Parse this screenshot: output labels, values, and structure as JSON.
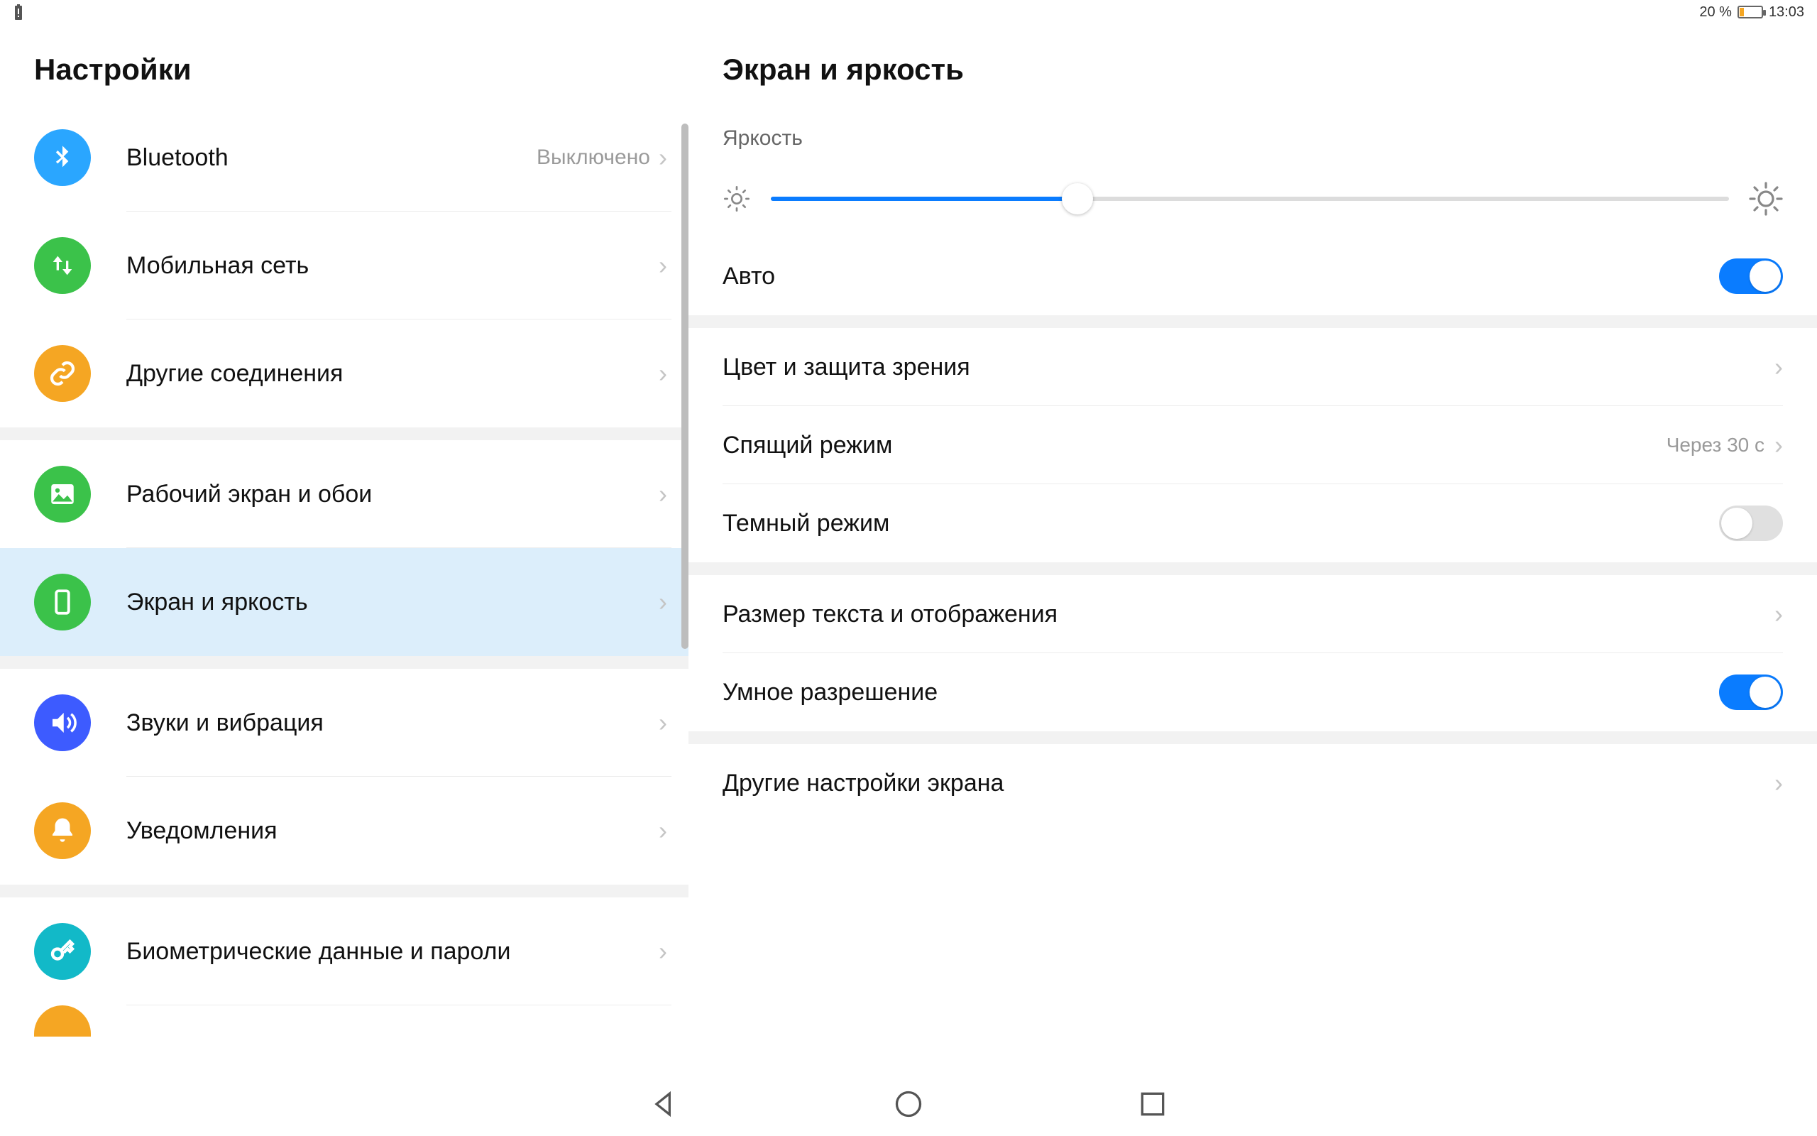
{
  "statusbar": {
    "battery_percent": "20 %",
    "time": "13:03"
  },
  "sidebar": {
    "title": "Настройки",
    "items": [
      {
        "label": "Bluetooth",
        "value": "Выключено",
        "icon": "bluetooth",
        "color": "#2aa6ff"
      },
      {
        "label": "Мобильная сеть",
        "icon": "updown",
        "color": "#3bc24a"
      },
      {
        "label": "Другие соединения",
        "icon": "link",
        "color": "#f5a623"
      },
      {
        "label": "Рабочий экран и обои",
        "icon": "image",
        "color": "#3bc24a"
      },
      {
        "label": "Экран и яркость",
        "icon": "phone",
        "color": "#3bc24a",
        "selected": true
      },
      {
        "label": "Звуки и вибрация",
        "icon": "sound",
        "color": "#3d5bff"
      },
      {
        "label": "Уведомления",
        "icon": "bell",
        "color": "#f5a623"
      },
      {
        "label": "Биометрические данные и пароли",
        "icon": "key",
        "color": "#12b9c8"
      }
    ]
  },
  "detail": {
    "title": "Экран и яркость",
    "brightness_group": "Яркость",
    "brightness_value_percent": 32,
    "auto_label": "Авто",
    "auto_on": true,
    "rows": {
      "color_protect": "Цвет и защита зрения",
      "sleep": "Спящий режим",
      "sleep_value": "Через 30 с",
      "dark_mode": "Темный режим",
      "dark_mode_on": false,
      "text_size": "Размер текста и отображения",
      "smart_res": "Умное разрешение",
      "smart_res_on": true,
      "other": "Другие настройки экрана"
    }
  }
}
